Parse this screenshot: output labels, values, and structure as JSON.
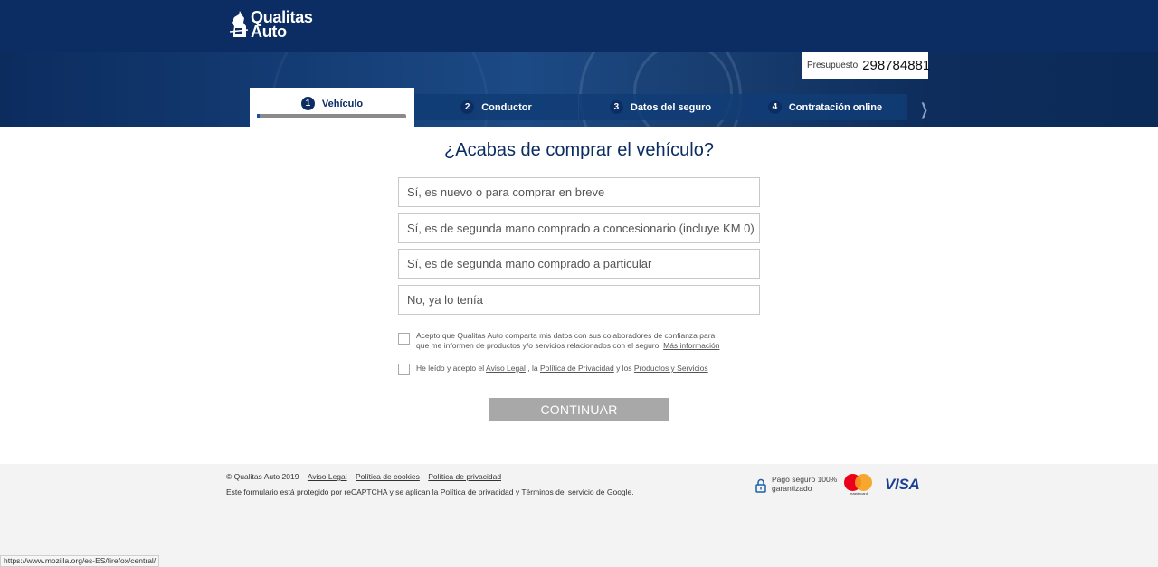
{
  "brand": {
    "name_line1": "Qualitas",
    "name_line2": "Auto"
  },
  "quote": {
    "label": "Presupuesto",
    "number": "298784881"
  },
  "steps": [
    {
      "num": "1",
      "label": "Vehículo",
      "active": true,
      "progress": 0.02
    },
    {
      "num": "2",
      "label": "Conductor",
      "active": false
    },
    {
      "num": "3",
      "label": "Datos del seguro",
      "active": false
    },
    {
      "num": "4",
      "label": "Contratación online",
      "active": false
    }
  ],
  "question": "¿Acabas de comprar el vehículo?",
  "options": [
    "Sí, es nuevo o para comprar en breve",
    "Sí, es de segunda mano comprado a concesionario (incluye KM 0)",
    "Sí, es de segunda mano comprado a particular",
    "No, ya lo tenía"
  ],
  "consent1": {
    "text": "Acepto que Qualitas Auto comparta mis datos con sus colaboradores de confianza para que me informen de productos y/o servicios relacionados con el seguro.",
    "link": "Más información"
  },
  "consent2": {
    "prefix": "He leído y acepto el",
    "link1": "Aviso Legal",
    "sep1": ", la",
    "link2": "Política de Privacidad",
    "sep2": "y los",
    "link3": "Productos y Servicios"
  },
  "continue_label": "CONTINUAR",
  "footer": {
    "copyright": "© Qualitas Auto 2019",
    "links": [
      "Aviso Legal",
      "Política de cookies",
      "Política de privacidad"
    ],
    "recaptcha_prefix": "Este formulario está protegido por reCAPTCHA y se aplican la",
    "recaptcha_link1": "Política de privacidad",
    "recaptcha_and": "y",
    "recaptcha_link2": "Términos del servicio",
    "recaptcha_suffix": "de Google.",
    "secure_text": "Pago seguro 100% garantizado",
    "mastercard_label": "mastercard",
    "visa_label": "VISA"
  },
  "statusbar_url": "https://www.mozilla.org/es-ES/firefox/central/",
  "colors": {
    "brand_navy": "#0b2d63",
    "button_disabled": "#a8a8a8"
  }
}
